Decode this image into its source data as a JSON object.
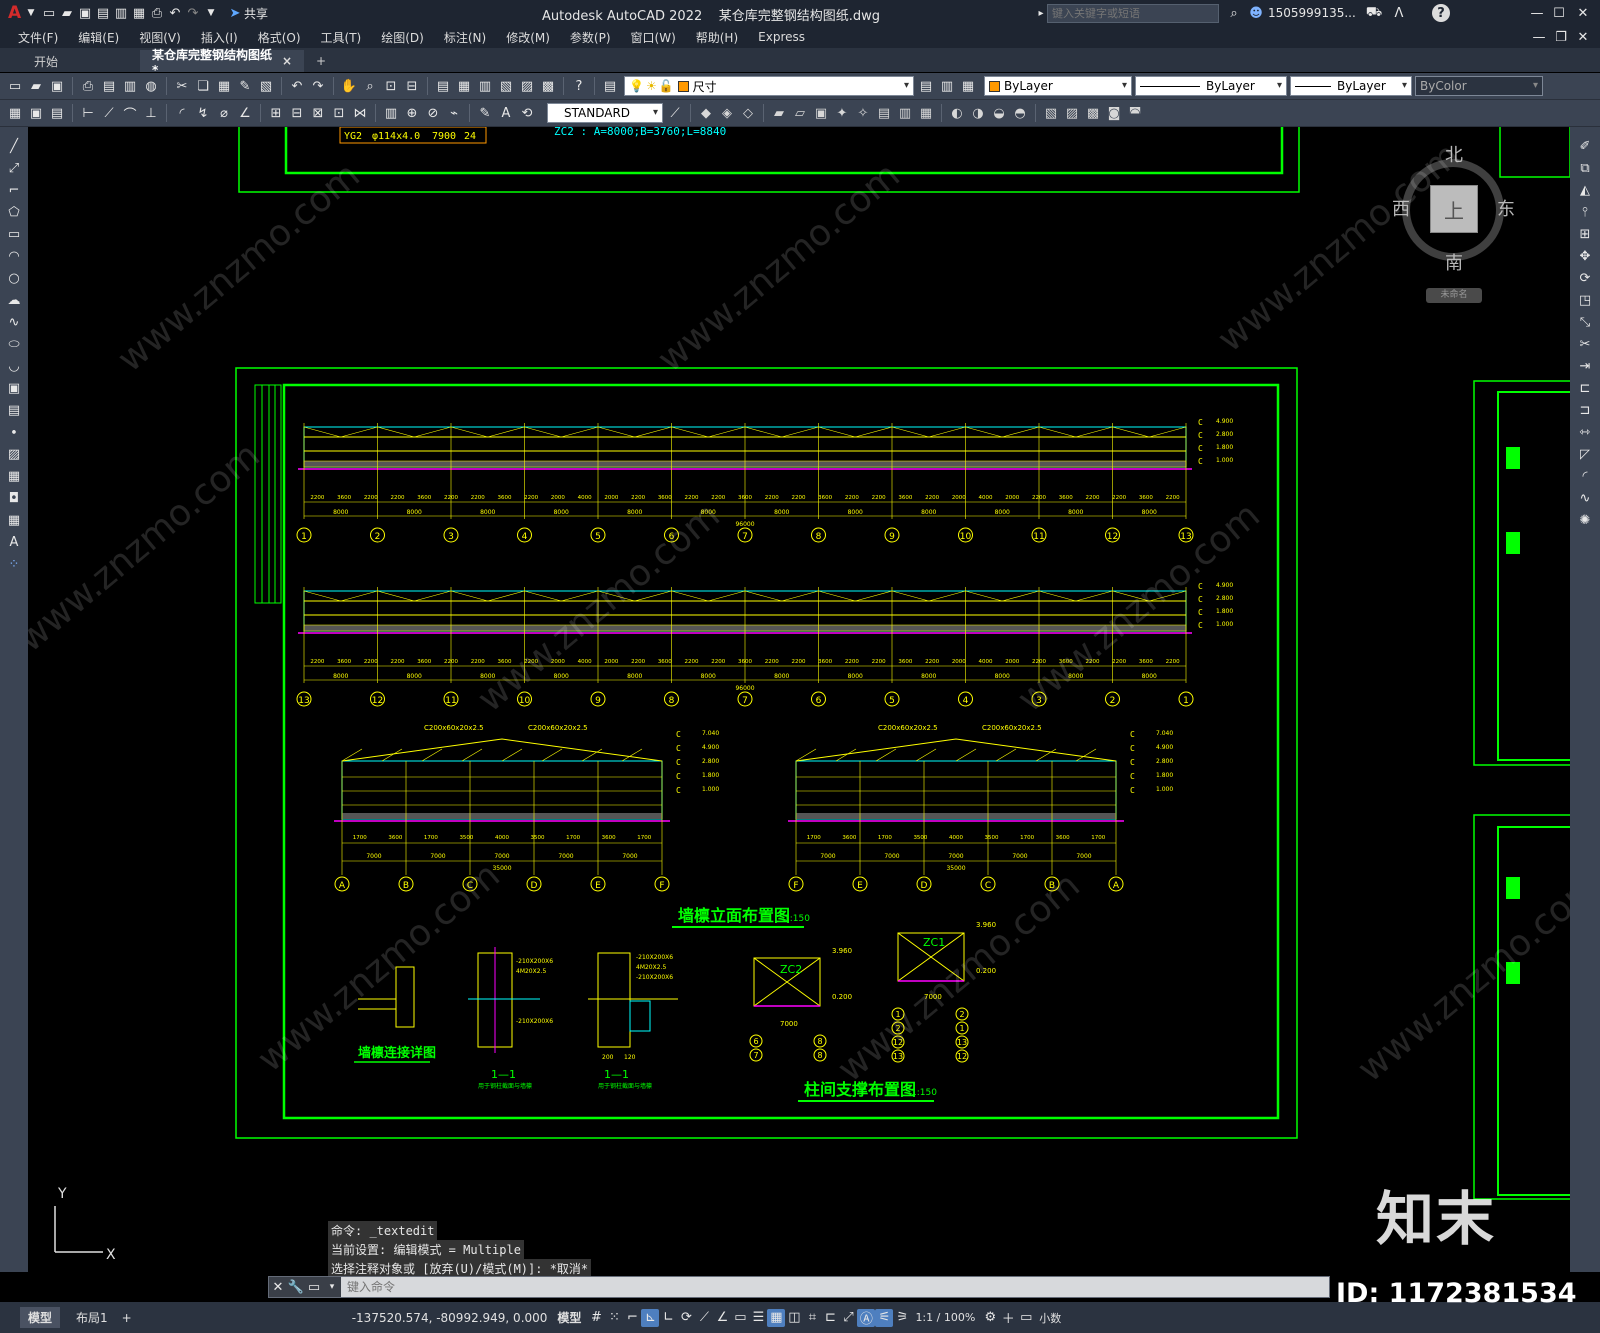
{
  "titlebar": {
    "app_letter": "A",
    "share_label": "共享",
    "title": "Autodesk AutoCAD 2022    某仓库完整钢结构图纸.dwg",
    "search_placeholder": "键入关键字或短语",
    "user": "1505999135...",
    "help": "?"
  },
  "menu": [
    "文件(F)",
    "编辑(E)",
    "视图(V)",
    "插入(I)",
    "格式(O)",
    "工具(T)",
    "绘图(D)",
    "标注(N)",
    "修改(M)",
    "参数(P)",
    "窗口(W)",
    "帮助(H)",
    "Express"
  ],
  "tabs": {
    "start": "开始",
    "doc": "某仓库完整钢结构图纸*",
    "close": "×",
    "add": "+"
  },
  "toolbar1": {
    "layer_value": "尺寸",
    "color_value": "ByLayer",
    "linetype_value": "ByLayer",
    "lineweight_value": "ByLayer",
    "plotstyle_value": "ByColor"
  },
  "toolbar2": {
    "text_style": "STANDARD"
  },
  "viewcube": {
    "north": "北",
    "south": "南",
    "east": "东",
    "west": "西",
    "top": "上",
    "wcs": "未命名"
  },
  "drawing": {
    "top_table": [
      "YG2",
      "φ114x4.0",
      "7900",
      "24"
    ],
    "top_note": "ZC2 : A=8000;B=3760;L=8840",
    "elev_row1_dims": [
      "2200",
      "3600",
      "2200",
      "2200",
      "3600",
      "2200",
      "2200",
      "3600",
      "2200",
      "2000",
      "4000",
      "2000",
      "2200",
      "3600",
      "2200",
      "2200",
      "3600",
      "2200",
      "2200",
      "3600",
      "2200",
      "2200",
      "3600",
      "2200",
      "2000",
      "4000",
      "2000",
      "2200",
      "3600",
      "2200",
      "2200",
      "3600",
      "2200"
    ],
    "elev_bays": [
      "8000",
      "8000",
      "8000",
      "8000",
      "8000",
      "8000",
      "8000",
      "8000",
      "8000",
      "8000",
      "8000",
      "8000"
    ],
    "elev_total": "96000",
    "axis_row1": [
      "1",
      "2",
      "3",
      "4",
      "5",
      "6",
      "7",
      "8",
      "9",
      "10",
      "11",
      "12",
      "13"
    ],
    "axis_row2": [
      "13",
      "12",
      "11",
      "10",
      "9",
      "8",
      "7",
      "6",
      "5",
      "4",
      "3",
      "2",
      "1"
    ],
    "levels1": [
      "4.900",
      "2.800",
      "1.800",
      "1.000"
    ],
    "gable_bays": [
      "7000",
      "7000",
      "7000",
      "7000",
      "7000"
    ],
    "gable_total": "35000",
    "gable_axes_left": [
      "A",
      "B",
      "C",
      "D",
      "E",
      "F"
    ],
    "gable_axes_right": [
      "F",
      "E",
      "D",
      "C",
      "B",
      "A"
    ],
    "gable_levels": [
      "7.040",
      "4.900",
      "2.800",
      "1.800",
      "1.000"
    ],
    "gable_member": "C200x60x20x2.5",
    "title_wall": "墙檩立面布置图",
    "scale_wall": "1:150",
    "detail1": "墙檩连接详图",
    "section1": "1—1",
    "section1_sub": "用于钢柱截面与墙檩",
    "section2": "1—1",
    "section2_sub": "用于钢柱截面与墙檩",
    "zc2": "ZC2",
    "zc1": "ZC1",
    "zc_dim": "7000",
    "zc_levels": [
      "3.960",
      "0.200"
    ],
    "zc2_axes": [
      "6",
      "8",
      "7",
      "8"
    ],
    "zc1_axes": [
      "1",
      "2",
      "2",
      "1",
      "12",
      "13",
      "13",
      "12"
    ],
    "title_brace": "柱间支撑布置图",
    "scale_brace": "1:150",
    "sec_dims": [
      "-210X200X6",
      "4M20X2.5",
      "-210X200X6"
    ],
    "sec2_dims": [
      "-210X200X6",
      "4M20X2.5",
      "-210X200X6",
      "200",
      "120"
    ],
    "gable_dims": [
      "1700",
      "3600",
      "1700",
      "3500",
      "4000",
      "3500",
      "1700",
      "3600",
      "1700"
    ]
  },
  "commands": {
    "line1": "命令: _textedit",
    "line2": "当前设置: 编辑模式 = Multiple",
    "line3": "选择注释对象或 [放弃(U)/模式(M)]: *取消*",
    "placeholder": "键入命令"
  },
  "status": {
    "model_tab": "模型",
    "layout_tab": "布局1",
    "add": "+",
    "coords": "-137520.574, -80992.949, 0.000",
    "model": "模型",
    "scale": "1:1 / 100%",
    "decimal": "小数"
  },
  "watermark": {
    "site": "www.znzmo.com",
    "brand": "知末网",
    "logo": "知末",
    "id": "ID: 1172381534"
  },
  "ucs": {
    "y": "Y",
    "x": "X"
  },
  "colors": {
    "drawing_green": "#00ff00",
    "cad_yellow": "#ffff00",
    "cad_cyan": "#00ffff",
    "cad_magenta": "#ff00ff",
    "cad_orange": "#ff9900",
    "panel_bg": "#3b4453"
  }
}
